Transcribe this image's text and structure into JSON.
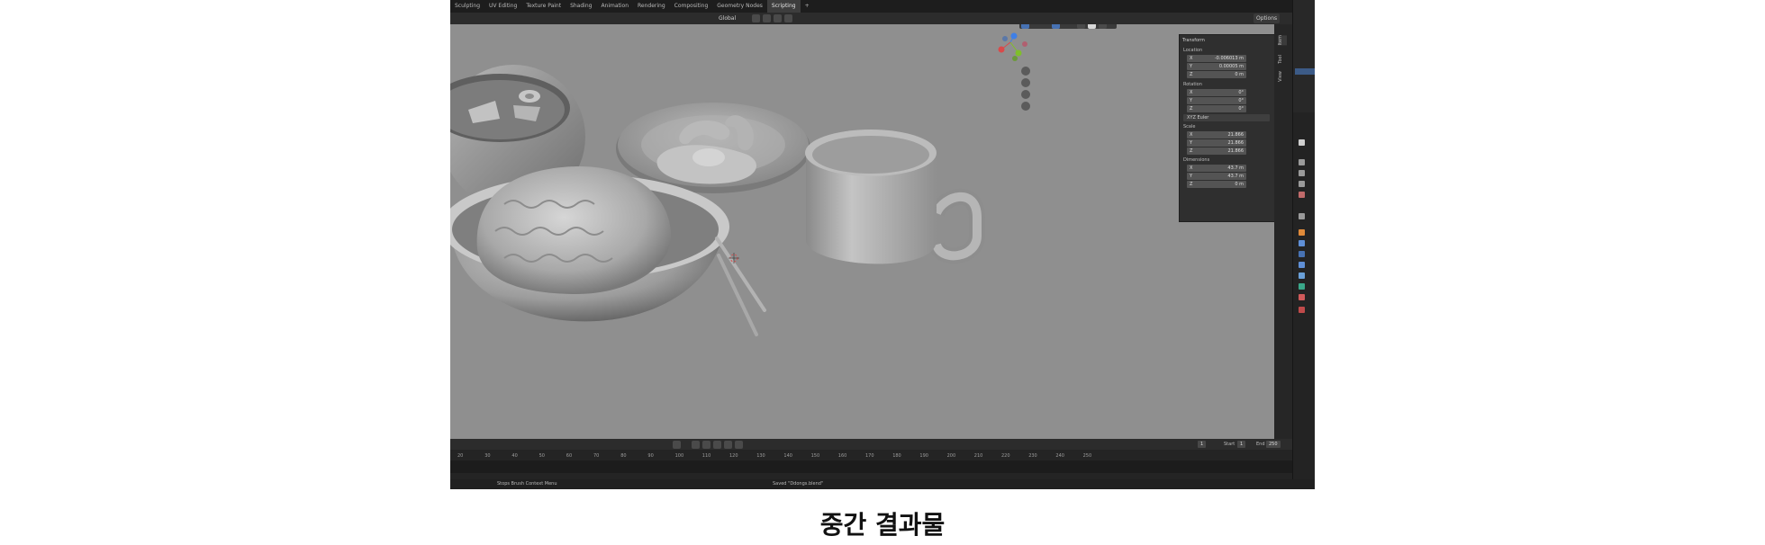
{
  "workspace_tabs": [
    "Sculpting",
    "UV Editing",
    "Texture Paint",
    "Shading",
    "Animation",
    "Rendering",
    "Compositing",
    "Geometry Nodes",
    "Scripting"
  ],
  "workspace_active_index": 8,
  "header": {
    "orientation": "Global",
    "options_label": "Options"
  },
  "npanel": {
    "section_title": "Transform",
    "location_label": "Location",
    "location": {
      "x": "-0.006013 m",
      "y": "0.00005 m",
      "z": "0 m"
    },
    "rotation_label": "Rotation",
    "rotation": {
      "x": "0°",
      "y": "0°",
      "z": "0°"
    },
    "rotation_mode": "XYZ Euler",
    "scale_label": "Scale",
    "scale": {
      "x": "21.866",
      "y": "21.866",
      "z": "21.866"
    },
    "dimensions_label": "Dimensions",
    "dimensions": {
      "x": "43.7 m",
      "y": "43.7 m",
      "z": "0 m"
    },
    "tabs": [
      "Item",
      "Tool",
      "View"
    ],
    "axis_labels": {
      "x": "X",
      "y": "Y",
      "z": "Z"
    }
  },
  "timeline": {
    "frame_ticks": [
      "20",
      "30",
      "40",
      "50",
      "60",
      "70",
      "80",
      "90",
      "100",
      "110",
      "120",
      "130",
      "140",
      "150",
      "160",
      "170",
      "180",
      "190",
      "200",
      "210",
      "220",
      "230",
      "240",
      "250"
    ],
    "current_frame": "1",
    "start_label": "Start",
    "start": "1",
    "end_label": "End",
    "end": "250"
  },
  "status": {
    "left": "Stops Brush Context Menu",
    "center": "Saved \"Ddongs.blend\""
  },
  "caption": "중간 결과물",
  "colors": {
    "viewport_bg": "#8f8f8f",
    "accent_blue": "#4772b3",
    "gizmo_x": "#d94a4a",
    "gizmo_y": "#7fbf2a",
    "gizmo_z": "#3f7fe6"
  }
}
